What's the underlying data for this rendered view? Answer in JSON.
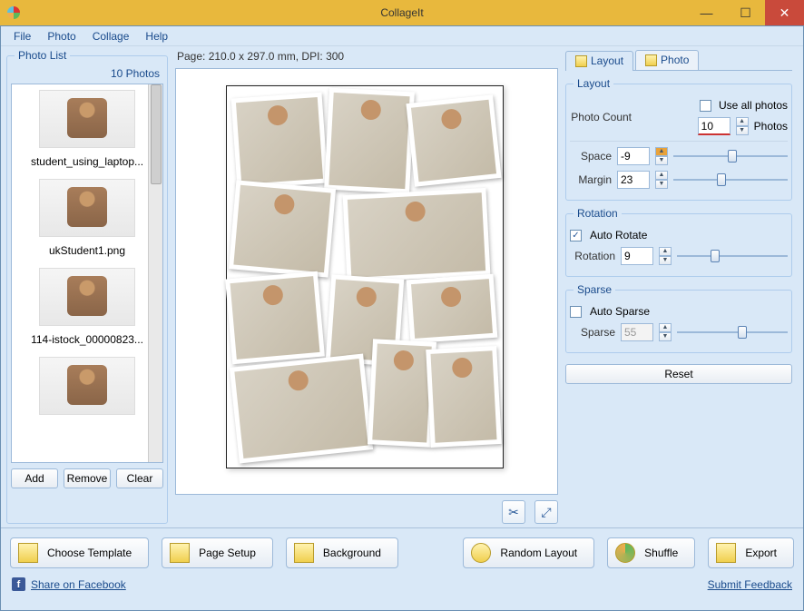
{
  "titlebar": {
    "title": "CollageIt"
  },
  "menu": {
    "file": "File",
    "photo": "Photo",
    "collage": "Collage",
    "help": "Help"
  },
  "photolist": {
    "title": "Photo List",
    "count": "10 Photos",
    "items": [
      {
        "name": "student_using_laptop..."
      },
      {
        "name": "ukStudent1.png"
      },
      {
        "name": "114-istock_00000823..."
      },
      {
        "name": ""
      }
    ],
    "add": "Add",
    "remove": "Remove",
    "clear": "Clear"
  },
  "page_info": "Page: 210.0 x 297.0 mm, DPI: 300",
  "tabs": {
    "layout": "Layout",
    "photo": "Photo"
  },
  "layout": {
    "group": "Layout",
    "count_label": "Photo Count",
    "use_all": "Use all photos",
    "count_value": "10",
    "photos_suffix": "Photos",
    "space_label": "Space",
    "space_value": "-9",
    "margin_label": "Margin",
    "margin_value": "23"
  },
  "rotation": {
    "group": "Rotation",
    "auto": "Auto Rotate",
    "rotation_label": "Rotation",
    "rotation_value": "9"
  },
  "sparse": {
    "group": "Sparse",
    "auto": "Auto Sparse",
    "label": "Sparse",
    "value": "55"
  },
  "reset": "Reset",
  "bottom": {
    "choose_template": "Choose Template",
    "page_setup": "Page Setup",
    "background": "Background",
    "random_layout": "Random Layout",
    "shuffle": "Shuffle",
    "export": "Export"
  },
  "links": {
    "share": "Share on Facebook",
    "feedback": "Submit Feedback"
  }
}
